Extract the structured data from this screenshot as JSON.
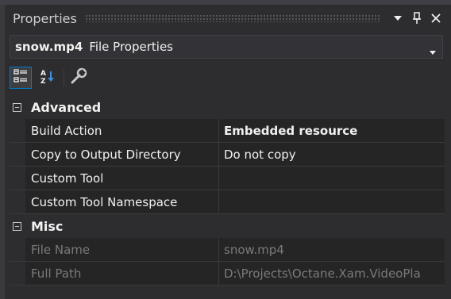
{
  "panel": {
    "title": "Properties"
  },
  "object": {
    "name": "snow.mp4",
    "type": "File Properties"
  },
  "categories": [
    {
      "label": "Advanced",
      "properties": [
        {
          "name": "Build Action",
          "value": "Embedded resource"
        },
        {
          "name": "Copy to Output Directory",
          "value": "Do not copy"
        },
        {
          "name": "Custom Tool",
          "value": ""
        },
        {
          "name": "Custom Tool Namespace",
          "value": ""
        }
      ]
    },
    {
      "label": "Misc",
      "properties": [
        {
          "name": "File Name",
          "value": "snow.mp4"
        },
        {
          "name": "Full Path",
          "value": "D:\\Projects\\Octane.Xam.VideoPla"
        }
      ]
    }
  ],
  "colors": {
    "accent": "#007acc",
    "background": "#2d2d30",
    "grid_bg": "#252526"
  },
  "icons": [
    "dropdown-arrow-icon",
    "pin-icon",
    "close-icon",
    "categorized-icon",
    "alphabetical-sort-icon",
    "property-pages-wrench-icon",
    "collapse-minus-icon"
  ]
}
